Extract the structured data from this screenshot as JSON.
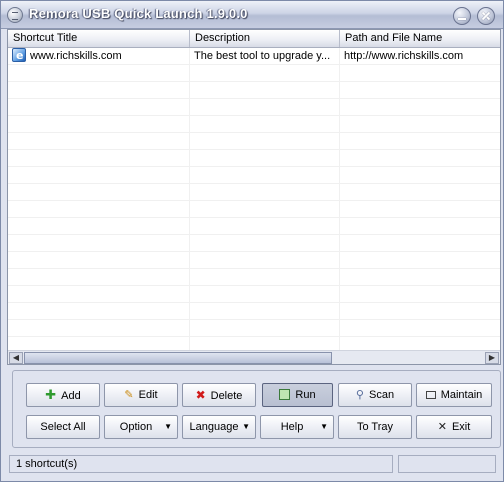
{
  "window": {
    "title": "Remora USB Quick Launch 1.9.0.0"
  },
  "list": {
    "columns": [
      "Shortcut Title",
      "Description",
      "Path and File Name"
    ],
    "rows": [
      {
        "icon": "ie-icon",
        "title": "www.richskills.com",
        "description": "The best tool to upgrade y...",
        "path": "http://www.richskills.com"
      }
    ]
  },
  "buttons": {
    "add": "Add",
    "edit": "Edit",
    "delete": "Delete",
    "run": "Run",
    "scan": "Scan",
    "maintain": "Maintain",
    "select_all": "Select All",
    "option": "Option",
    "language": "Language",
    "help": "Help",
    "to_tray": "To Tray",
    "exit": "Exit"
  },
  "status": {
    "count_text": "1 shortcut(s)"
  }
}
